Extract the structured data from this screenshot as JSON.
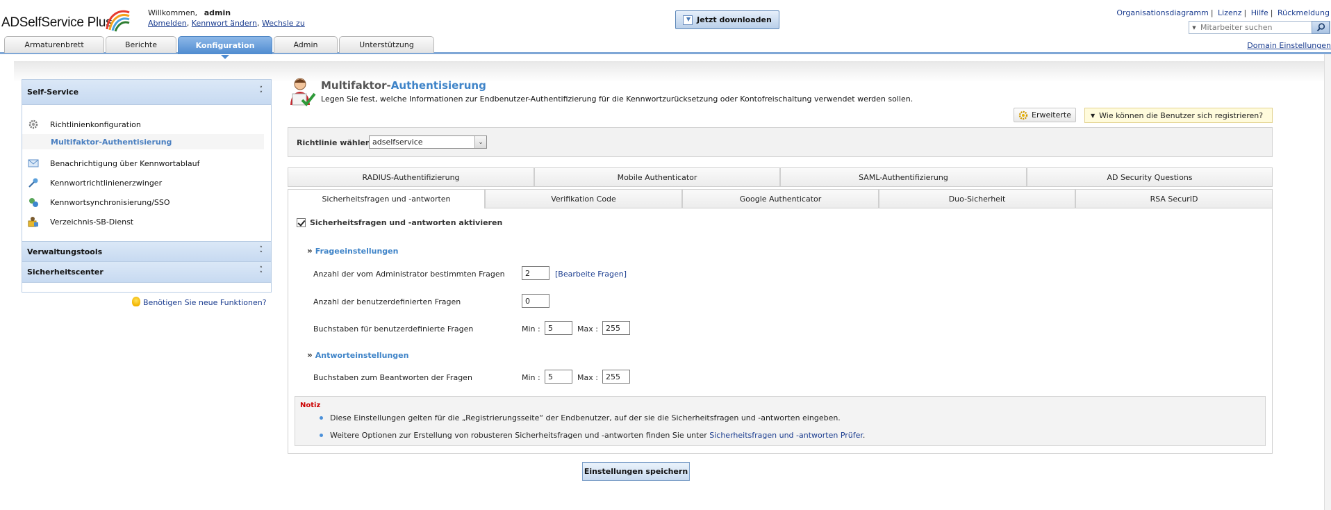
{
  "header": {
    "logo_text": "ADSelfService Plus",
    "welcome_label": "Willkommen,",
    "username": "admin",
    "logout": "Abmelden",
    "change_password": "Kennwort ändern",
    "switch_to": "Wechsle zu",
    "download_button": "Jetzt downloaden",
    "top_links": [
      "Organisationsdiagramm",
      "Lizenz",
      "Hilfe",
      "Rückmeldung"
    ],
    "search_placeholder": "Mitarbeiter suchen",
    "search_icon": "magnifier-icon"
  },
  "nav": {
    "tabs": [
      "Armaturenbrett",
      "Berichte",
      "Konfiguration",
      "Admin",
      "Unterstützung"
    ],
    "active": "Konfiguration",
    "domain_settings": "Domain Einstellungen"
  },
  "sidebar": {
    "self_service": "Self-Service",
    "items": [
      {
        "label": "Richtlinienkonfiguration",
        "icon": "gear-icon"
      },
      {
        "label": "Multifaktor-Authentisierung",
        "sub": true
      },
      {
        "label": "Benachrichtigung über Kennwortablauf",
        "icon": "envelope-icon"
      },
      {
        "label": "Kennwortrichtlinienerzwinger",
        "icon": "key-icon"
      },
      {
        "label": "Kennwortsynchronisierung/SSO",
        "icon": "sync-icon"
      },
      {
        "label": "Verzeichnis-SB-Dienst",
        "icon": "directory-icon"
      }
    ],
    "management_tools": "Verwaltungstools",
    "security_center": "Sicherheitscenter",
    "need_features": "Benötigen Sie neue Funktionen?"
  },
  "content": {
    "title_prefix": "Multifaktor-",
    "title_highlight": "Authentisierung",
    "description": "Legen Sie fest, welche Informationen zur Endbenutzer-Authentifizierung für die Kennwortzurücksetzung oder Kontofreischaltung verwendet werden sollen.",
    "advanced_button": "Erweiterte",
    "how_register_button": "Wie können die Benutzer sich registrieren?",
    "policy_label": "Richtlinie wählen",
    "policy_value": "adselfservice",
    "tabs_row1": [
      "RADIUS-Authentifizierung",
      "Mobile Authenticator",
      "SAML-Authentifizierung",
      "AD Security Questions"
    ],
    "tabs_row2": [
      "Sicherheitsfragen und -antworten",
      "Verifikation Code",
      "Google Authenticator",
      "Duo-Sicherheit",
      "RSA SecurID"
    ],
    "active_tab": "Sicherheitsfragen und -antworten",
    "enable_label": "Sicherheitsfragen und -antworten aktivieren",
    "enabled": true,
    "question_settings": "Frageeinstellungen",
    "admin_questions_label": "Anzahl der vom Administrator bestimmten Fragen",
    "admin_questions_value": "2",
    "edit_questions": "[Bearbeite Fragen]",
    "user_questions_label": "Anzahl der benutzerdefinierten Fragen",
    "user_questions_value": "0",
    "user_question_chars_label": "Buchstaben für benutzerdefinierte Fragen",
    "min_label": "Min :",
    "max_label": "Max :",
    "q_min": "5",
    "q_max": "255",
    "answer_settings": "Antworteinstellungen",
    "answer_chars_label": "Buchstaben zum Beantworten der Fragen",
    "a_min": "5",
    "a_max": "255",
    "note_title": "Notiz",
    "note_1": "Diese Einstellungen gelten für die „Registrierungsseite“ der Endbenutzer, auf der sie die Sicherheitsfragen und -antworten eingeben.",
    "note_2_prefix": "Weitere Optionen zur Erstellung von robusteren Sicherheitsfragen und -antworten finden Sie unter ",
    "note_2_link": "Sicherheitsfragen und -antworten Prüfer",
    "note_2_suffix": ".",
    "save_button": "Einstellungen speichern"
  }
}
